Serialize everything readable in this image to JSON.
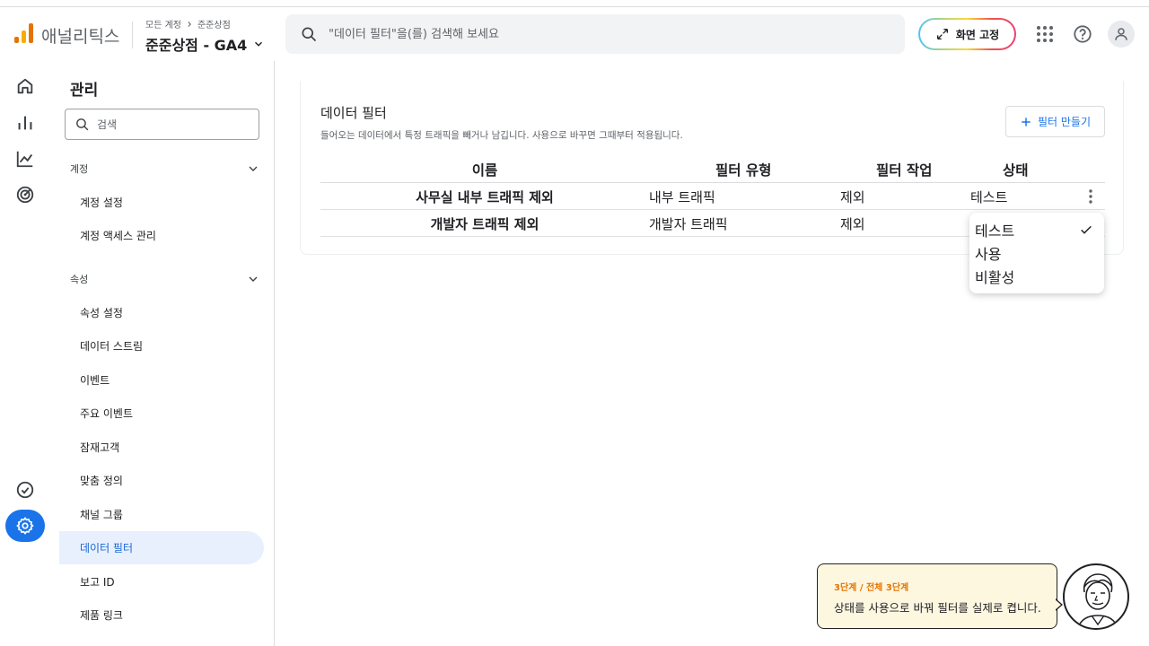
{
  "header": {
    "app_name": "애널리틱스",
    "breadcrumb_account": "모든 계정",
    "breadcrumb_property": "준준상점",
    "property_name": "준준상점 - GA4",
    "search_placeholder": "\"데이터 필터\"을(를) 검색해 보세요",
    "pin_label": "화면 고정"
  },
  "rail": {
    "icons": [
      "home-icon",
      "reports-icon",
      "explore-icon",
      "advertising-icon",
      "check-circle-icon",
      "gear-icon"
    ]
  },
  "sidebar": {
    "title": "관리",
    "search_placeholder": "검색",
    "sections": [
      {
        "label": "계정",
        "items": [
          "계정 설정",
          "계정 액세스 관리"
        ]
      },
      {
        "label": "속성",
        "items": [
          "속성 설정",
          "데이터 스트림",
          "이벤트",
          "주요 이벤트",
          "잠재고객",
          "맞춤 정의",
          "채널 그룹",
          "데이터 필터",
          "보고 ID",
          "제품 링크"
        ]
      }
    ],
    "active_item": "데이터 필터"
  },
  "main": {
    "title": "데이터 필터",
    "description": "들어오는 데이터에서 특정 트래픽을 빼거나 남깁니다. 사용으로 바꾸면 그때부터 적용됩니다.",
    "new_filter_label": "필터 만들기",
    "columns": [
      "이름",
      "필터 유형",
      "필터 작업",
      "상태"
    ],
    "rows": [
      {
        "name": "사무실 내부 트래픽 제외",
        "type": "내부 트래픽",
        "operation": "제외",
        "state": "테스트"
      },
      {
        "name": "개발자 트래픽 제외",
        "type": "개발자 트래픽",
        "operation": "제외",
        "state": ""
      }
    ]
  },
  "dropdown": {
    "options": [
      "테스트",
      "사용",
      "비활성"
    ],
    "selected": "테스트"
  },
  "tooltip": {
    "step": "3단계 / 전체 3단계",
    "text": "상태를 사용으로 바꿔 필터를 실제로 켭니다."
  },
  "colors": {
    "accent": "#1a73e8",
    "active_bg": "#e8f0fe",
    "tip_bg": "#fef7e0",
    "tip_step": "#e37400",
    "logo_orange": "#e37400",
    "logo_yellow": "#f9ab00"
  }
}
